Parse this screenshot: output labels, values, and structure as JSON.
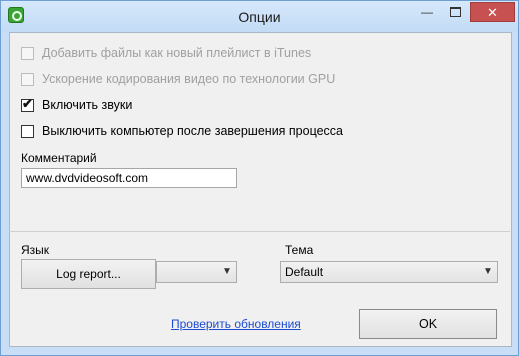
{
  "window": {
    "title": "Опции",
    "minimize": "—",
    "close": "✕"
  },
  "options": {
    "add_itunes": {
      "label": "Добавить файлы как новый плейлист в iTunes",
      "checked": false,
      "enabled": false
    },
    "gpu": {
      "label": "Ускорение кодирования видео по технологии GPU",
      "checked": false,
      "enabled": false
    },
    "sounds": {
      "label": "Включить звуки",
      "checked": true,
      "enabled": true
    },
    "shutdown": {
      "label": "Выключить компьютер после завершения процесса",
      "checked": false,
      "enabled": true
    }
  },
  "comment": {
    "label": "Комментарий",
    "value": "www.dvdvideosoft.com"
  },
  "language": {
    "label": "Язык",
    "log_report_label": "Log report...",
    "selected": ""
  },
  "theme": {
    "label": "Тема",
    "selected": "Default"
  },
  "footer": {
    "update_link": "Проверить обновления",
    "ok_label": "OK"
  }
}
